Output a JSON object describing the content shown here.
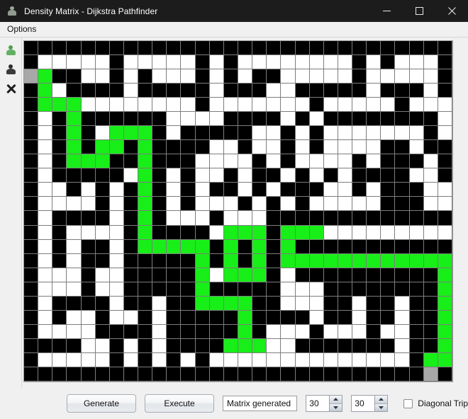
{
  "window": {
    "title": "Density Matrix - Dijkstra Pathfinder",
    "icon": "java-duke-icon",
    "minimize_label": "minimize-icon",
    "maximize_label": "maximize-icon",
    "close_label": "close-icon"
  },
  "menubar": {
    "items": [
      {
        "label": "Options"
      }
    ]
  },
  "toolbar": {
    "items": [
      {
        "name": "set-start-node-tool",
        "icon": "green-person-icon",
        "tooltip": "Start node"
      },
      {
        "name": "set-end-node-tool",
        "icon": "dark-person-icon",
        "tooltip": "End node"
      },
      {
        "name": "clear-tool",
        "icon": "x-cross-icon",
        "tooltip": "Clear"
      }
    ]
  },
  "controls": {
    "generate_label": "Generate",
    "execute_label": "Execute",
    "status_value": "Matrix generated",
    "status_placeholder": "Matrix generated",
    "rows_value": "30",
    "cols_value": "30",
    "diagonal_label": "Diagonal Trip",
    "diagonal_checked": false
  },
  "colors": {
    "wall": "#000000",
    "open": "#ffffff",
    "path": "#18ee18",
    "node": "#a8a8a8",
    "titlebar": "#1c1c1c",
    "chrome": "#f0f0f0"
  },
  "grid": {
    "rows": 24,
    "cols": 30,
    "legend": {
      "0": "open",
      "1": "wall",
      "2": "path",
      "3": "node"
    },
    "cells": [
      [
        1,
        1,
        1,
        1,
        1,
        1,
        1,
        1,
        1,
        1,
        1,
        1,
        1,
        1,
        1,
        1,
        1,
        1,
        1,
        1,
        1,
        1,
        1,
        1,
        1,
        1,
        1,
        1,
        1,
        1
      ],
      [
        1,
        0,
        0,
        0,
        0,
        0,
        1,
        0,
        0,
        0,
        0,
        0,
        1,
        0,
        1,
        0,
        0,
        0,
        0,
        0,
        0,
        0,
        0,
        1,
        0,
        1,
        0,
        0,
        0,
        1
      ],
      [
        3,
        2,
        1,
        1,
        0,
        0,
        1,
        0,
        1,
        0,
        0,
        0,
        1,
        0,
        1,
        0,
        1,
        1,
        0,
        0,
        0,
        0,
        0,
        1,
        0,
        0,
        0,
        0,
        0,
        1
      ],
      [
        1,
        2,
        0,
        1,
        1,
        1,
        1,
        0,
        1,
        1,
        1,
        1,
        1,
        0,
        1,
        1,
        1,
        0,
        0,
        1,
        1,
        1,
        1,
        1,
        0,
        1,
        1,
        1,
        0,
        1
      ],
      [
        1,
        2,
        2,
        2,
        0,
        0,
        0,
        0,
        0,
        0,
        0,
        0,
        1,
        0,
        0,
        0,
        0,
        0,
        0,
        0,
        1,
        0,
        0,
        0,
        0,
        0,
        1,
        0,
        0,
        0
      ],
      [
        1,
        0,
        1,
        2,
        1,
        1,
        1,
        1,
        1,
        1,
        0,
        0,
        0,
        0,
        1,
        1,
        1,
        1,
        0,
        1,
        0,
        1,
        1,
        1,
        1,
        1,
        1,
        1,
        1,
        0
      ],
      [
        1,
        0,
        1,
        2,
        1,
        0,
        2,
        2,
        2,
        1,
        0,
        1,
        1,
        1,
        1,
        1,
        0,
        0,
        1,
        0,
        1,
        0,
        0,
        0,
        0,
        0,
        0,
        0,
        1,
        0
      ],
      [
        1,
        0,
        1,
        2,
        1,
        2,
        2,
        1,
        2,
        1,
        1,
        1,
        1,
        0,
        0,
        1,
        0,
        0,
        1,
        0,
        1,
        0,
        0,
        0,
        0,
        1,
        1,
        0,
        1,
        1
      ],
      [
        1,
        0,
        1,
        2,
        2,
        2,
        1,
        1,
        2,
        1,
        1,
        1,
        0,
        0,
        0,
        0,
        1,
        0,
        1,
        0,
        0,
        0,
        0,
        1,
        0,
        1,
        1,
        1,
        0,
        1
      ],
      [
        1,
        0,
        1,
        1,
        1,
        1,
        1,
        0,
        2,
        1,
        0,
        1,
        0,
        0,
        1,
        0,
        1,
        1,
        0,
        1,
        0,
        1,
        0,
        1,
        1,
        1,
        1,
        0,
        0,
        1
      ],
      [
        1,
        0,
        0,
        1,
        0,
        1,
        0,
        1,
        2,
        1,
        0,
        1,
        0,
        1,
        1,
        0,
        1,
        0,
        1,
        1,
        1,
        0,
        0,
        1,
        0,
        1,
        1,
        1,
        0,
        0
      ],
      [
        1,
        0,
        0,
        0,
        0,
        1,
        0,
        1,
        2,
        1,
        0,
        1,
        0,
        0,
        0,
        1,
        0,
        1,
        0,
        1,
        0,
        0,
        0,
        0,
        0,
        1,
        1,
        1,
        0,
        0
      ],
      [
        1,
        0,
        1,
        1,
        1,
        1,
        0,
        1,
        2,
        1,
        0,
        0,
        0,
        1,
        0,
        0,
        0,
        1,
        1,
        1,
        1,
        1,
        1,
        1,
        1,
        1,
        1,
        1,
        1,
        1
      ],
      [
        1,
        0,
        1,
        0,
        0,
        0,
        0,
        1,
        2,
        1,
        1,
        1,
        1,
        0,
        2,
        2,
        2,
        1,
        2,
        2,
        2,
        0,
        0,
        0,
        0,
        0,
        0,
        0,
        0,
        0
      ],
      [
        1,
        0,
        1,
        0,
        1,
        1,
        0,
        1,
        2,
        2,
        2,
        2,
        2,
        1,
        2,
        1,
        2,
        1,
        2,
        1,
        1,
        1,
        1,
        1,
        1,
        1,
        1,
        1,
        1,
        1
      ],
      [
        1,
        0,
        1,
        0,
        1,
        1,
        0,
        1,
        1,
        1,
        1,
        1,
        2,
        1,
        2,
        1,
        2,
        1,
        2,
        2,
        2,
        2,
        2,
        2,
        2,
        2,
        2,
        2,
        2,
        2
      ],
      [
        1,
        0,
        0,
        0,
        1,
        0,
        0,
        1,
        1,
        1,
        1,
        1,
        2,
        0,
        2,
        2,
        2,
        1,
        0,
        1,
        1,
        1,
        1,
        1,
        1,
        1,
        1,
        1,
        1,
        2
      ],
      [
        1,
        0,
        0,
        0,
        1,
        0,
        0,
        1,
        1,
        1,
        1,
        1,
        2,
        1,
        1,
        1,
        1,
        1,
        0,
        0,
        0,
        1,
        1,
        1,
        1,
        1,
        1,
        1,
        1,
        2
      ],
      [
        1,
        0,
        1,
        1,
        1,
        1,
        0,
        1,
        1,
        0,
        1,
        1,
        2,
        2,
        2,
        2,
        1,
        1,
        0,
        0,
        0,
        1,
        1,
        0,
        1,
        1,
        0,
        1,
        1,
        2
      ],
      [
        1,
        0,
        1,
        0,
        0,
        1,
        0,
        0,
        1,
        0,
        1,
        1,
        1,
        1,
        1,
        2,
        1,
        1,
        1,
        1,
        0,
        1,
        1,
        0,
        1,
        1,
        0,
        1,
        1,
        2
      ],
      [
        1,
        0,
        0,
        0,
        0,
        1,
        1,
        1,
        1,
        0,
        1,
        1,
        1,
        1,
        1,
        2,
        1,
        0,
        0,
        0,
        1,
        0,
        0,
        0,
        1,
        0,
        0,
        1,
        1,
        2
      ],
      [
        1,
        1,
        1,
        1,
        0,
        0,
        1,
        0,
        1,
        0,
        1,
        1,
        1,
        1,
        2,
        2,
        2,
        0,
        0,
        1,
        1,
        1,
        1,
        1,
        1,
        1,
        0,
        1,
        1,
        2
      ],
      [
        1,
        0,
        0,
        0,
        0,
        0,
        1,
        0,
        1,
        0,
        1,
        0,
        1,
        0,
        0,
        0,
        0,
        0,
        0,
        0,
        0,
        0,
        0,
        0,
        0,
        0,
        0,
        1,
        2,
        2
      ],
      [
        1,
        1,
        1,
        1,
        1,
        1,
        1,
        1,
        1,
        1,
        1,
        1,
        1,
        1,
        1,
        1,
        1,
        1,
        1,
        1,
        1,
        1,
        1,
        1,
        1,
        1,
        1,
        1,
        3,
        1
      ]
    ]
  }
}
